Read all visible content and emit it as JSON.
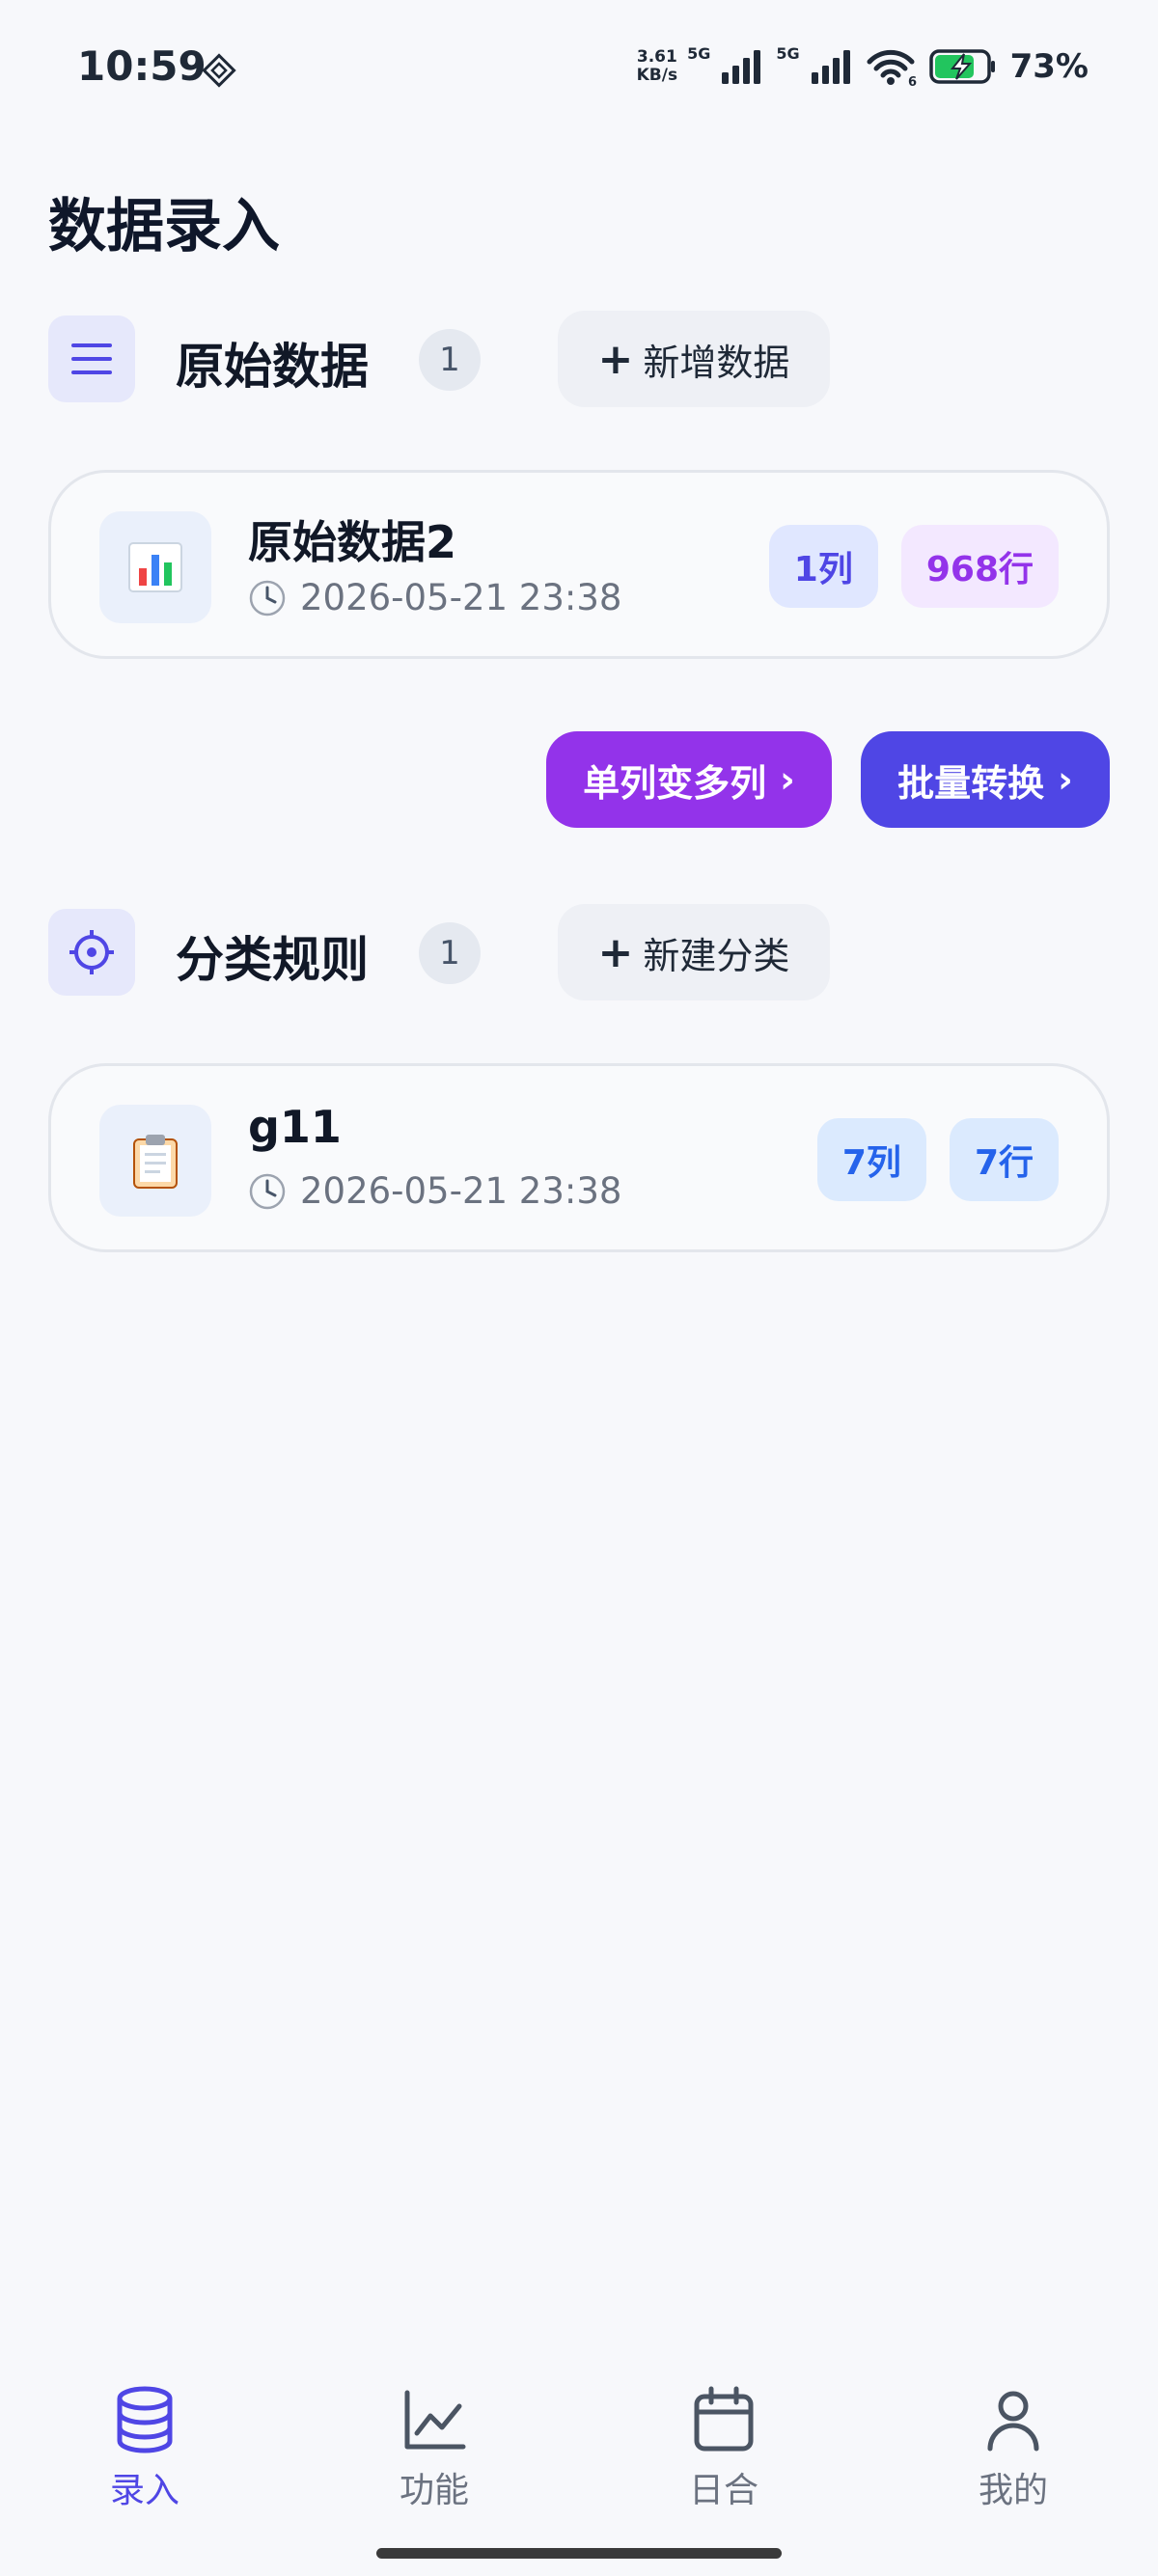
{
  "status_bar": {
    "time": "10:59",
    "net_speed_value": "3.61",
    "net_speed_unit": "KB/s",
    "sim1": "5G",
    "sim2": "5G",
    "wifi_badge": "6",
    "battery": "73%",
    "icons": [
      "dnd-icon",
      "signal-icon",
      "wifi-icon",
      "battery-charging-icon"
    ]
  },
  "page": {
    "title": "数据录入"
  },
  "raw_section": {
    "icon": "list-icon",
    "title": "原始数据",
    "count": "1",
    "add_label": "新增数据",
    "items": [
      {
        "icon": "bar-chart-icon",
        "title": "原始数据2",
        "time": "2026-05-21 23:38",
        "tag_cols": "1列",
        "tag_rows": "968行"
      }
    ]
  },
  "actions": {
    "split_label": "单列变多列",
    "batch_label": "批量转换",
    "arrow": "›",
    "colors": {
      "split": "#9333ea",
      "batch": "#4f46e5"
    }
  },
  "rule_section": {
    "icon": "gear-icon",
    "title": "分类规则",
    "count": "1",
    "add_label": "新建分类",
    "items": [
      {
        "icon": "clipboard-icon",
        "title": "g11",
        "time": "2026-05-21 23:38",
        "tag_cols": "7列",
        "tag_rows": "7行"
      }
    ]
  },
  "nav": {
    "items": [
      {
        "label": "录入",
        "icon": "database-icon",
        "active": true
      },
      {
        "label": "功能",
        "icon": "chart-line-icon",
        "active": false
      },
      {
        "label": "日合",
        "icon": "calendar-icon",
        "active": false
      },
      {
        "label": "我的",
        "icon": "user-icon",
        "active": false
      }
    ],
    "accent": "#4f46e5"
  }
}
